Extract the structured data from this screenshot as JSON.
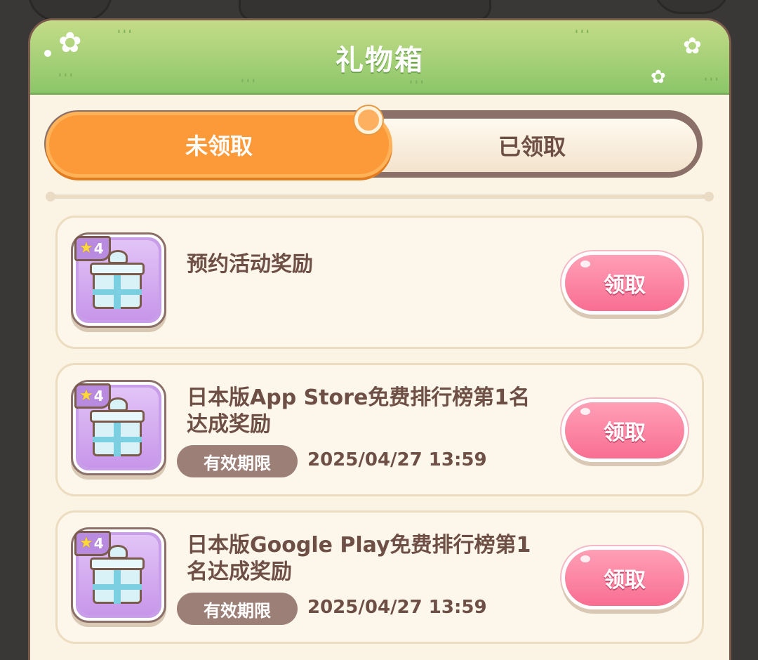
{
  "dialog": {
    "title": "礼物箱"
  },
  "tabs": {
    "unclaimed": "未领取",
    "claimed": "已领取",
    "active": "unclaimed"
  },
  "items": [
    {
      "title": "预约活动奖励",
      "badge": "4",
      "expiry_label": "",
      "expiry_value": "",
      "claim": "领取"
    },
    {
      "title": "日本版App Store免费排行榜第1名达成奖励",
      "badge": "4",
      "expiry_label": "有效期限",
      "expiry_value": "2025/04/27 13:59",
      "claim": "领取"
    },
    {
      "title": "日本版Google Play免费排行榜第1名达成奖励",
      "badge": "4",
      "expiry_label": "有效期限",
      "expiry_value": "2025/04/27 13:59",
      "claim": "领取"
    }
  ],
  "colors": {
    "header_green": "#8cc66a",
    "tab_active": "#fc9a3a",
    "claim_pink": "#f86e92",
    "text_brown": "#6e4f45",
    "gift_purple": "#c99ee8"
  }
}
